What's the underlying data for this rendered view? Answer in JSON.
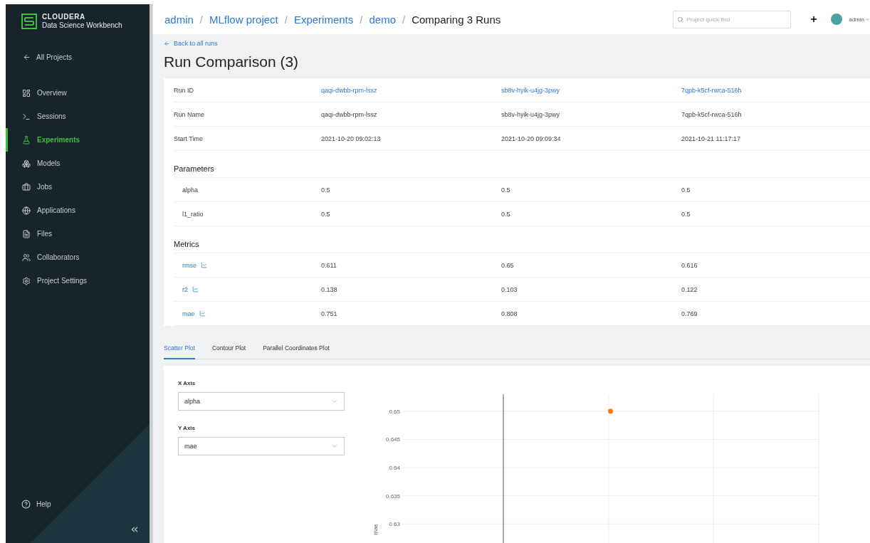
{
  "sidebar": {
    "logo": {
      "brand": "CLOUDERA",
      "product": "Data Science Workbench"
    },
    "back": "All Projects",
    "items": [
      {
        "label": "Overview",
        "kind": "overview",
        "selected": false
      },
      {
        "label": "Sessions",
        "kind": "sessions",
        "selected": false
      },
      {
        "label": "Experiments",
        "kind": "experiments",
        "selected": true
      },
      {
        "label": "Models",
        "kind": "models",
        "selected": false
      },
      {
        "label": "Jobs",
        "kind": "jobs",
        "selected": false
      },
      {
        "label": "Applications",
        "kind": "applications",
        "selected": false
      },
      {
        "label": "Files",
        "kind": "files",
        "selected": false
      },
      {
        "label": "Collaborators",
        "kind": "collaborators",
        "selected": false
      },
      {
        "label": "Project Settings",
        "kind": "settings",
        "selected": false
      }
    ],
    "help": "Help"
  },
  "header": {
    "breadcrumbs": [
      "admin",
      "MLflow project",
      "Experiments",
      "demo"
    ],
    "separator": "/",
    "current": "Comparing 3 Runs",
    "search": {
      "placeholder": "Project quick find"
    },
    "user": "admin"
  },
  "back_link": "Back to all runs",
  "title": "Run Comparison (3)",
  "run_rows": [
    {
      "label": "Run ID",
      "kind": "link",
      "values": [
        "qaqi-dwbb-rpm-lssz",
        "sb8v-hyik-u4jg-3pwy",
        "7qpb-k5cf-rwca-516h"
      ]
    },
    {
      "label": "Run Name",
      "kind": "text",
      "values": [
        "qaqi-dwbb-rpm-lssz",
        "sb8v-hyik-u4jg-3pwy",
        "7qpb-k5cf-rwca-516h"
      ]
    },
    {
      "label": "Start Time",
      "kind": "text",
      "values": [
        "2021-10-20 09:02:13",
        "2021-10-20 09:09:34",
        "2021-10-21 11:17:17"
      ]
    }
  ],
  "parameters": {
    "title": "Parameters",
    "rows": [
      {
        "name": "alpha",
        "values": [
          "0.5",
          "0.5",
          "0.5"
        ]
      },
      {
        "name": "l1_ratio",
        "values": [
          "0.5",
          "0.5",
          "0.5"
        ]
      }
    ]
  },
  "metrics": {
    "title": "Metrics",
    "rows": [
      {
        "name": "rmse",
        "values": [
          "0.611",
          "0.65",
          "0.616"
        ]
      },
      {
        "name": "r2",
        "values": [
          "0.138",
          "0.103",
          "0.122"
        ]
      },
      {
        "name": "mae",
        "values": [
          "0.751",
          "0.808",
          "0.769"
        ]
      }
    ]
  },
  "tabs": [
    {
      "label": "Scatter Plot",
      "selected": true
    },
    {
      "label": "Contour Plot",
      "selected": false
    },
    {
      "label": "Parallel Coordinates Plot",
      "selected": false
    }
  ],
  "plot": {
    "x_axis": {
      "label": "X Axis",
      "value": "alpha"
    },
    "y_axis": {
      "label": "Y Axis",
      "value": "mae"
    },
    "chart_data": {
      "type": "scatter",
      "ylabel": "mae",
      "values": [
        0.65
      ],
      "ylim": [
        0.6265,
        0.653
      ],
      "yticks": [
        0.63,
        0.635,
        0.64,
        0.645,
        0.65
      ],
      "grid": true
    }
  }
}
